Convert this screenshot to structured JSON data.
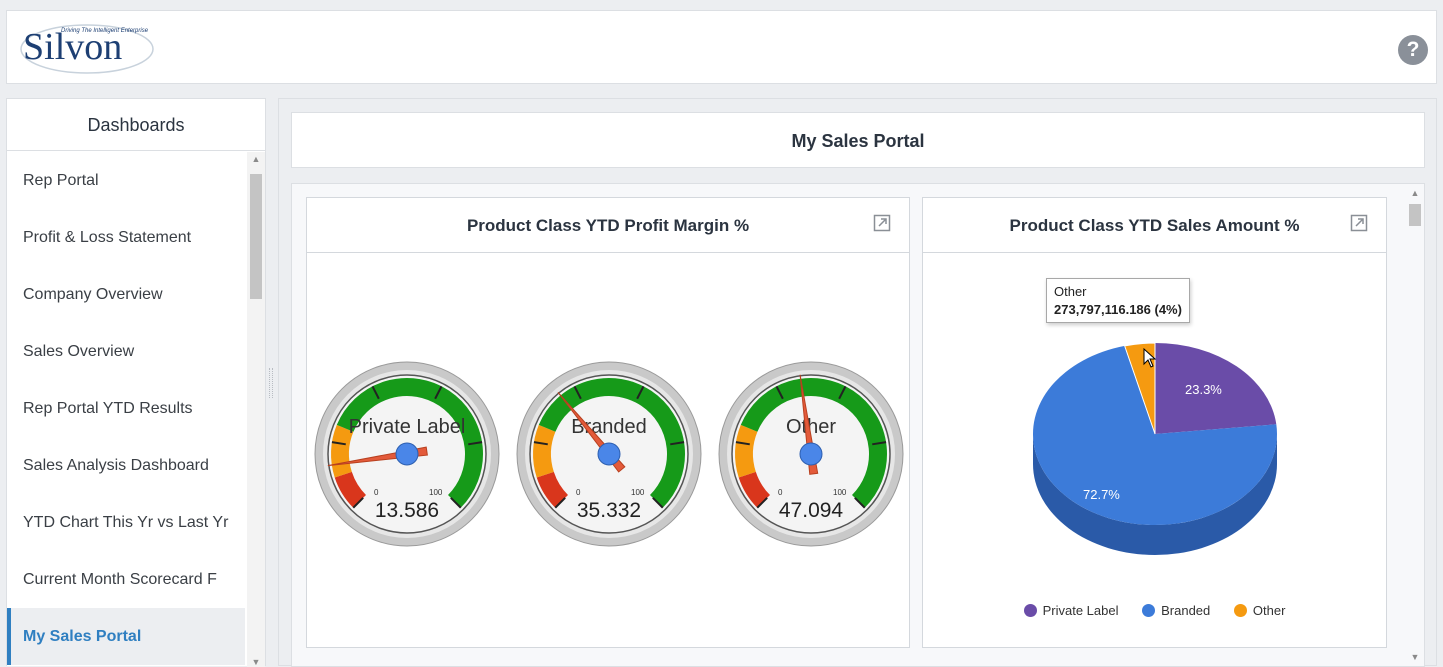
{
  "header": {
    "logo_text": "Silvon",
    "logo_tagline": "Driving The Intelligent Enterprise",
    "help_label": "?"
  },
  "sidebar": {
    "title": "Dashboards",
    "items": [
      {
        "label": "Rep Portal"
      },
      {
        "label": "Profit & Loss Statement"
      },
      {
        "label": "Company Overview"
      },
      {
        "label": "Sales Overview"
      },
      {
        "label": "Rep Portal YTD Results"
      },
      {
        "label": "Sales Analysis Dashboard"
      },
      {
        "label": "YTD Chart This Yr vs Last Yr"
      },
      {
        "label": "Current Month Scorecard F"
      },
      {
        "label": "My Sales Portal"
      }
    ],
    "active_index": 8
  },
  "main": {
    "title": "My Sales Portal",
    "gauge_panel": {
      "title": "Product Class YTD Profit Margin %",
      "gauges": [
        {
          "label": "Private Label",
          "value": 13.586,
          "value_text": "13.586",
          "min": "0",
          "max": "100"
        },
        {
          "label": "Branded",
          "value": 35.332,
          "value_text": "35.332",
          "min": "0",
          "max": "100"
        },
        {
          "label": "Other",
          "value": 47.094,
          "value_text": "47.094",
          "min": "0",
          "max": "100"
        }
      ]
    },
    "pie_panel": {
      "title": "Product Class YTD Sales Amount %",
      "tooltip": {
        "name": "Other",
        "value": "273,797,116.186 (4%)"
      },
      "slice_labels": [
        "23.3%",
        "72.7%"
      ],
      "legend": [
        {
          "label": "Private Label",
          "color": "#6a4ca8"
        },
        {
          "label": "Branded",
          "color": "#3c7bd9"
        },
        {
          "label": "Other",
          "color": "#f59a10"
        }
      ]
    }
  },
  "chart_data": [
    {
      "type": "gauge",
      "title": "Product Class YTD Profit Margin %",
      "categories": [
        "Private Label",
        "Branded",
        "Other"
      ],
      "values": [
        13.586,
        35.332,
        47.094
      ],
      "ylim": [
        0,
        100
      ]
    },
    {
      "type": "pie",
      "title": "Product Class YTD Sales Amount %",
      "categories": [
        "Private Label",
        "Branded",
        "Other"
      ],
      "values": [
        23.3,
        72.7,
        4
      ],
      "colors": [
        "#6a4ca8",
        "#3c7bd9",
        "#f59a10"
      ],
      "tooltip": {
        "category": "Other",
        "value": "273,797,116.186 (4%)"
      }
    }
  ]
}
